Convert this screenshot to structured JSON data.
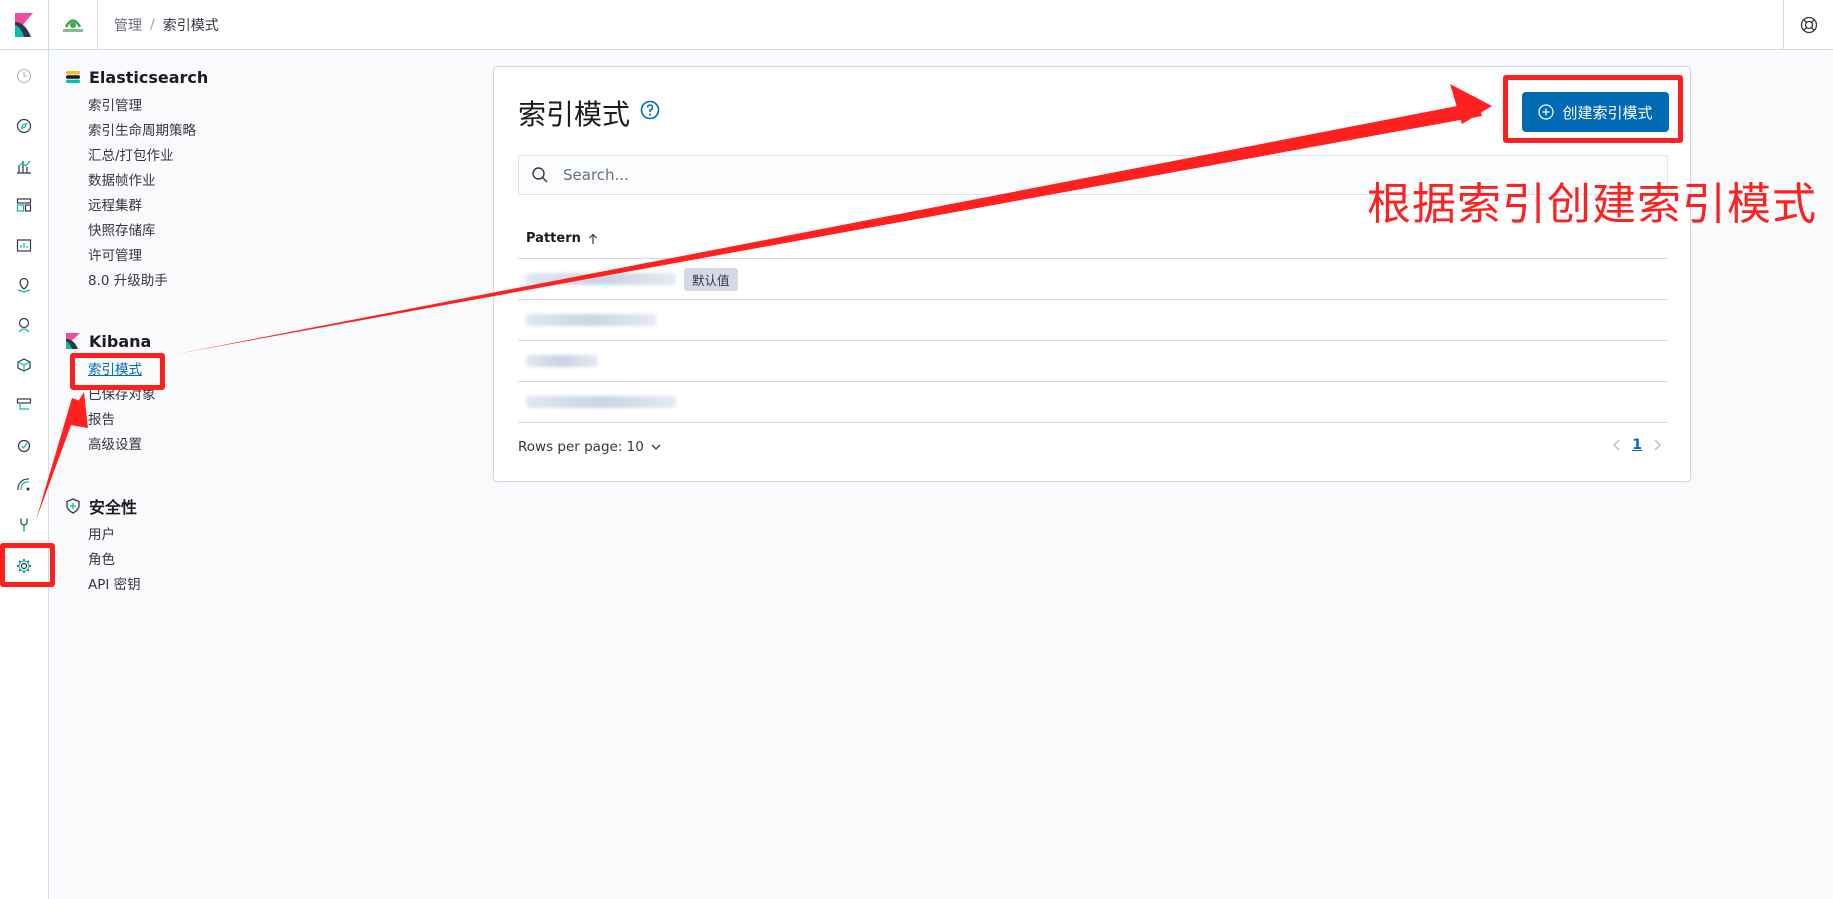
{
  "header": {
    "breadcrumbs": [
      "管理",
      "索引模式"
    ],
    "help_icon": "lifebuoy-icon"
  },
  "icon_nav": [
    {
      "name": "recent-icon"
    },
    {
      "name": "discover-icon"
    },
    {
      "name": "visualize-icon"
    },
    {
      "name": "dashboard-icon"
    },
    {
      "name": "canvas-icon"
    },
    {
      "name": "maps-icon"
    },
    {
      "name": "ml-icon"
    },
    {
      "name": "infrastructure-icon"
    },
    {
      "name": "logs-icon"
    },
    {
      "name": "uptime-icon"
    },
    {
      "name": "siem-icon"
    },
    {
      "name": "devtools-icon"
    },
    {
      "name": "gear-icon"
    }
  ],
  "sidebar": {
    "elasticsearch": {
      "title": "Elasticsearch",
      "items": [
        "索引管理",
        "索引生命周期策略",
        "汇总/打包作业",
        "数据帧作业",
        "远程集群",
        "快照存储库",
        "许可管理",
        "8.0 升级助手"
      ]
    },
    "kibana": {
      "title": "Kibana",
      "items": [
        "索引模式",
        "已保存对象",
        "报告",
        "高级设置"
      ]
    },
    "security": {
      "title": "安全性",
      "items": [
        "用户",
        "角色",
        "API 密钥"
      ]
    }
  },
  "main": {
    "title": "索引模式",
    "create_button": "创建索引模式",
    "search_placeholder": "Search...",
    "column_header": "Pattern",
    "default_badge": "默认值",
    "rows_per_page": "Rows per page: 10",
    "current_page": "1"
  },
  "annotation": {
    "text": "根据索引创建索引模式",
    "color": "#ff2020"
  },
  "colors": {
    "primary": "#006bb4",
    "border": "#d3dae6"
  }
}
